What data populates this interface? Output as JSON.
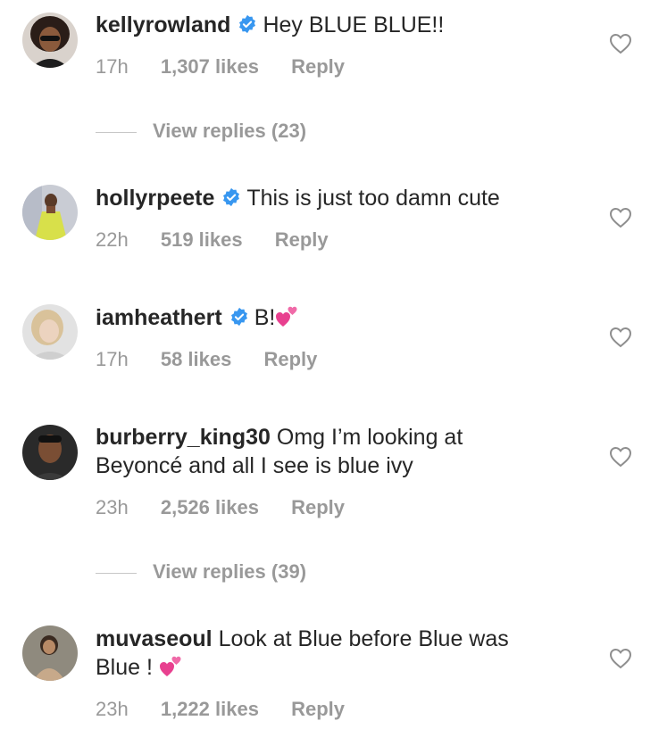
{
  "comments": [
    {
      "username": "kellyrowland",
      "verified": true,
      "text": "Hey BLUE BLUE!!",
      "time": "17h",
      "likes": "1,307 likes",
      "reply": "Reply",
      "view_replies": "View replies (23)"
    },
    {
      "username": "hollyrpeete",
      "verified": true,
      "text": "This is just too damn cute",
      "time": "22h",
      "likes": "519 likes",
      "reply": "Reply"
    },
    {
      "username": "iamheathert",
      "verified": true,
      "text": "B!",
      "emoji": "two-hearts-emoji",
      "time": "17h",
      "likes": "58 likes",
      "reply": "Reply"
    },
    {
      "username": "burberry_king30",
      "verified": false,
      "text_line1": "Omg I’m looking at",
      "text_line2": "Beyoncé and all I see is blue ivy",
      "time": "23h",
      "likes": "2,526 likes",
      "reply": "Reply",
      "view_replies": "View replies (39)"
    },
    {
      "username": "muvaseoul",
      "verified": false,
      "text_line1": "Look at Blue before Blue was",
      "text_line2": "Blue !",
      "emoji": "two-hearts-emoji",
      "time": "23h",
      "likes": "1,222 likes",
      "reply": "Reply"
    }
  ],
  "colors": {
    "text": "#262626",
    "meta": "#999999",
    "verified": "#3897f0",
    "emoji": "#e8408f"
  }
}
